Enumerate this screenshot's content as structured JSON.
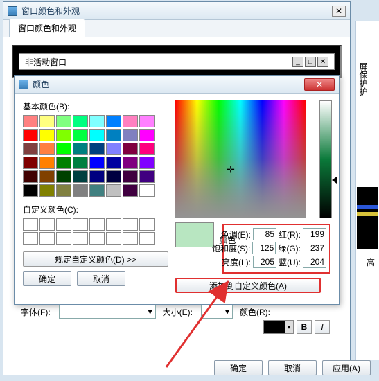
{
  "outer": {
    "title": "窗口颜色和外观",
    "tab": "窗口颜色和外观",
    "inactive_window_label": "非活动窗口",
    "side_tab": "屏保护护"
  },
  "colordlg": {
    "title": "颜色",
    "basic_label": "基本颜色(B):",
    "custom_label": "自定义颜色(C):",
    "define_btn": "规定自定义颜色(D) >>",
    "ok": "确定",
    "cancel": "取消",
    "color_word": "颜色",
    "add_btn": "添加到自定义颜色(A)",
    "hue_l": "色调(E):",
    "hue_v": "85",
    "sat_l": "饱和度(S):",
    "sat_v": "125",
    "lum_l": "亮度(L):",
    "lum_v": "205",
    "r_l": "红(R):",
    "r_v": "199",
    "g_l": "绿(G):",
    "g_v": "237",
    "b_l": "蓝(U):",
    "b_v": "204",
    "basic_colors": [
      "#ff8080",
      "#ffff80",
      "#80ff80",
      "#00ff80",
      "#80ffff",
      "#0080ff",
      "#ff80c0",
      "#ff80ff",
      "#ff0000",
      "#ffff00",
      "#80ff00",
      "#00ff40",
      "#00ffff",
      "#0080c0",
      "#8080c0",
      "#ff00ff",
      "#804040",
      "#ff8040",
      "#00ff00",
      "#008080",
      "#004080",
      "#8080ff",
      "#800040",
      "#ff0080",
      "#800000",
      "#ff8000",
      "#008000",
      "#008040",
      "#0000ff",
      "#0000a0",
      "#800080",
      "#8000ff",
      "#400000",
      "#804000",
      "#004000",
      "#004040",
      "#000080",
      "#000040",
      "#400040",
      "#400080",
      "#000000",
      "#808000",
      "#808040",
      "#808080",
      "#408080",
      "#c0c0c0",
      "#400040",
      "#ffffff"
    ]
  },
  "form": {
    "font_l": "字体(F):",
    "size_l": "大小(E):",
    "color_l": "颜色(R):",
    "bold": "B",
    "italic": "I",
    "high": "高"
  },
  "finals": {
    "ok": "确定",
    "cancel": "取消",
    "apply": "应用(A)"
  }
}
